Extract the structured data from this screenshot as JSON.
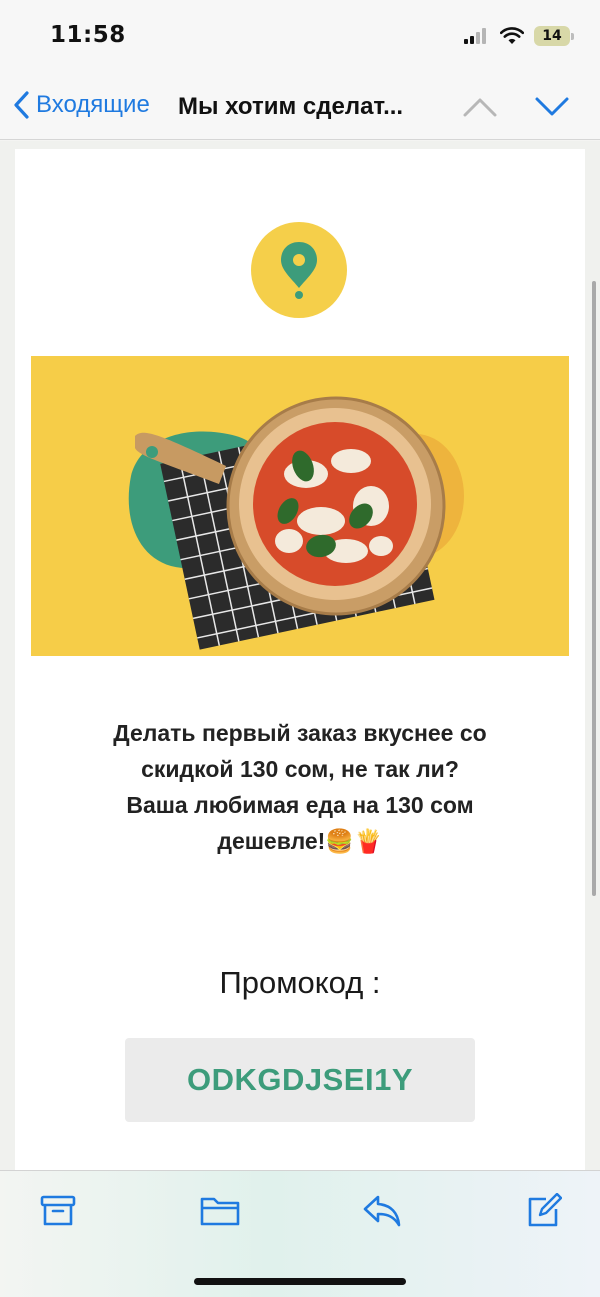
{
  "status_bar": {
    "time": "11:58",
    "battery": "14",
    "icons": [
      "signal-icon",
      "wifi-icon",
      "battery-icon"
    ]
  },
  "nav": {
    "back_label": "Входящие",
    "title": "Мы хотим сделат...",
    "icons": [
      "chevron-left-icon",
      "chevron-up-icon",
      "chevron-down-icon"
    ]
  },
  "email": {
    "logo_icon": "location-pin-icon",
    "hero_image": "pizza-on-wooden-board",
    "promo_lines": [
      "Делать первый заказ вкуснее со",
      "скидкой 130 сом, не так ли?",
      "Ваша любимая еда на 130 сом",
      "дешевле!🍔🍟"
    ],
    "promo_label": "Промокод :",
    "promo_code": "ODKGDJSEI1Y"
  },
  "toolbar": {
    "items": [
      "archive-icon",
      "folder-icon",
      "reply-icon",
      "compose-icon"
    ]
  },
  "colors": {
    "accent_blue": "#1f7ae0",
    "brand_yellow": "#f6cd48",
    "brand_green": "#3d9c7b",
    "promo_box": "#ebebeb"
  }
}
